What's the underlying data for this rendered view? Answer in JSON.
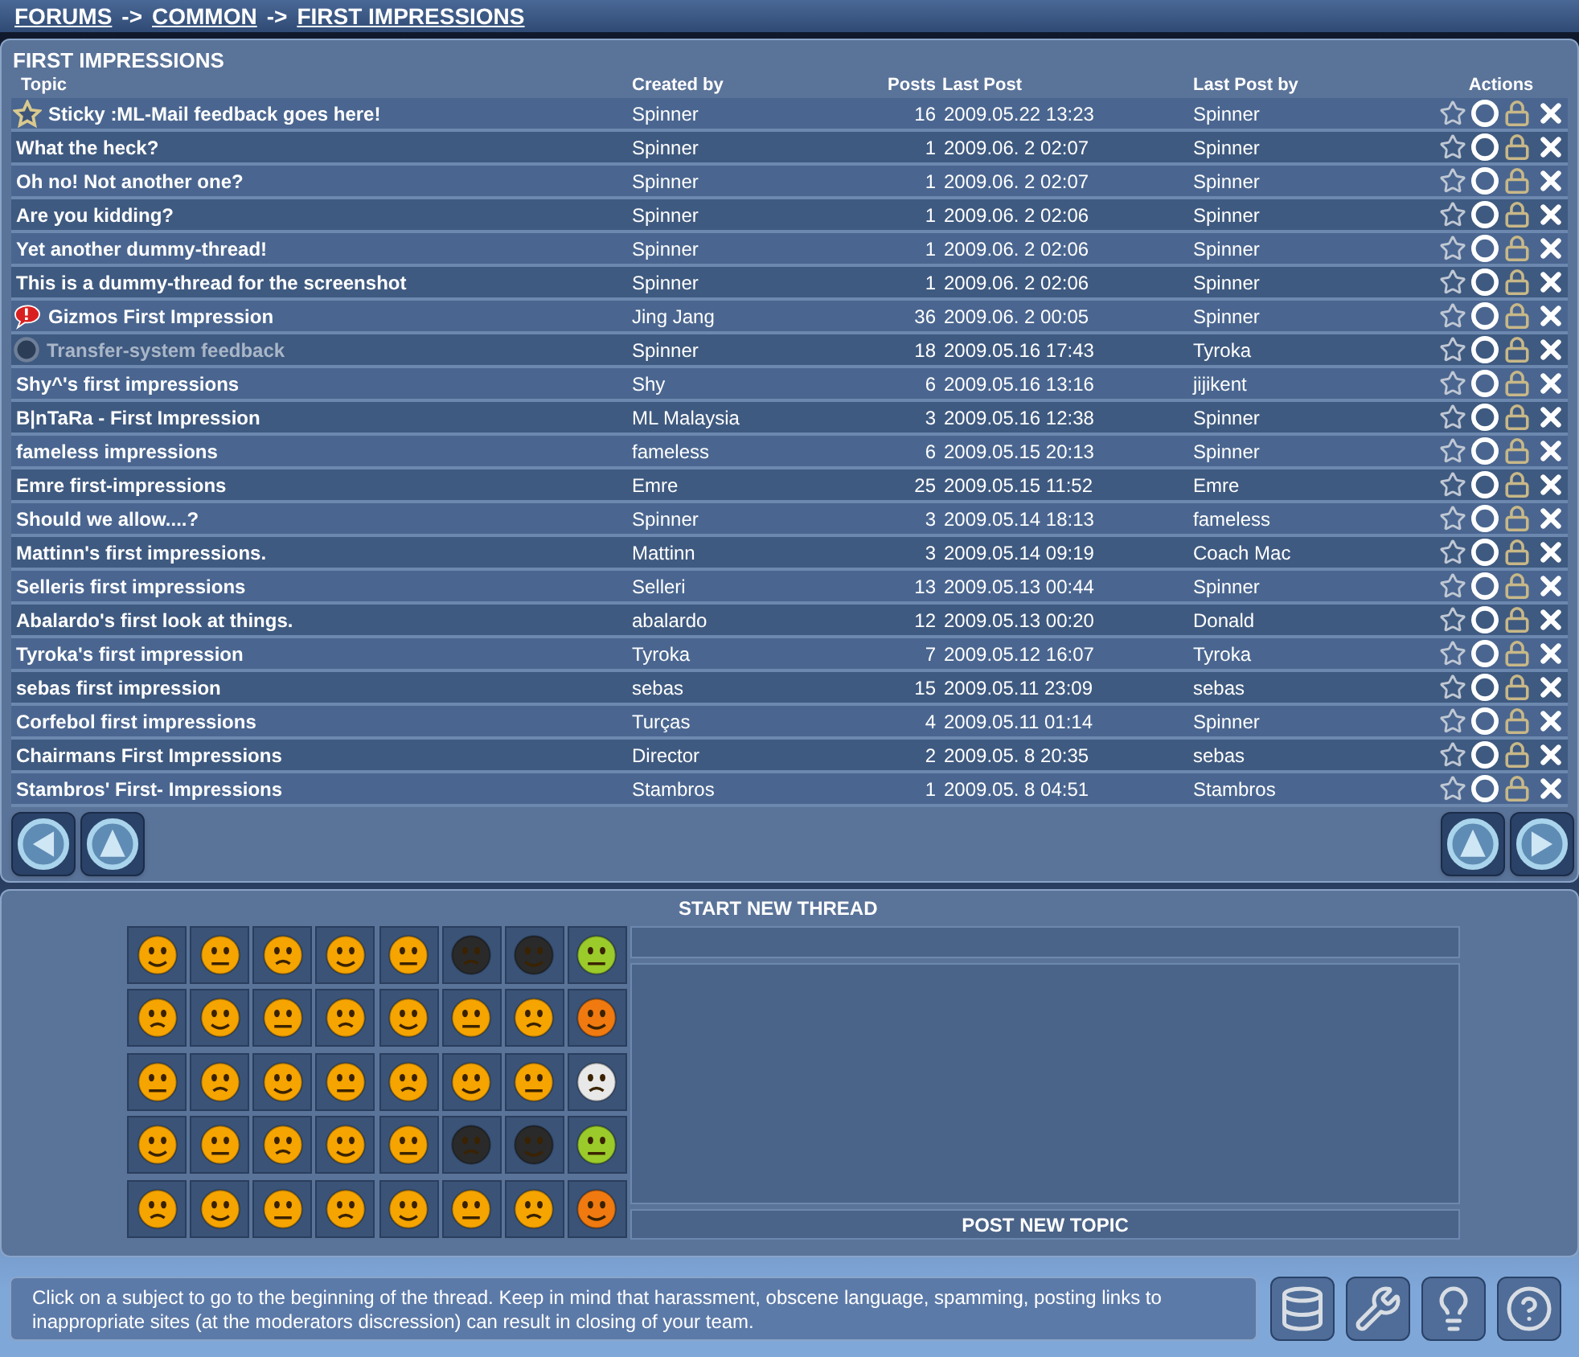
{
  "breadcrumb": {
    "items": [
      "FORUMS",
      "COMMON",
      "FIRST IMPRESSIONS"
    ],
    "separators": [
      "->",
      "->"
    ]
  },
  "forum": {
    "title": "FIRST IMPRESSIONS",
    "columns": [
      "Topic",
      "Created by",
      "Posts",
      "Last Post",
      "Last Post by",
      "Actions"
    ],
    "rows": [
      {
        "kind": "sticky",
        "topic": "Sticky :ML-Mail feedback goes here!",
        "created_by": "Spinner",
        "posts": "16",
        "last_post": "2009.05.22 13:23",
        "last_post_by": "Spinner"
      },
      {
        "kind": "normal",
        "topic": "What the heck?",
        "created_by": "Spinner",
        "posts": "1",
        "last_post": "2009.06. 2 02:07",
        "last_post_by": "Spinner"
      },
      {
        "kind": "normal",
        "topic": "Oh no! Not another one?",
        "created_by": "Spinner",
        "posts": "1",
        "last_post": "2009.06. 2 02:07",
        "last_post_by": "Spinner"
      },
      {
        "kind": "normal",
        "topic": "Are you kidding?",
        "created_by": "Spinner",
        "posts": "1",
        "last_post": "2009.06. 2 02:06",
        "last_post_by": "Spinner"
      },
      {
        "kind": "normal",
        "topic": "Yet another dummy-thread!",
        "created_by": "Spinner",
        "posts": "1",
        "last_post": "2009.06. 2 02:06",
        "last_post_by": "Spinner"
      },
      {
        "kind": "normal",
        "topic": "This is a dummy-thread for the screenshot",
        "created_by": "Spinner",
        "posts": "1",
        "last_post": "2009.06. 2 02:06",
        "last_post_by": "Spinner"
      },
      {
        "kind": "alert",
        "topic": "Gizmos First Impression",
        "created_by": "Jing Jang",
        "posts": "36",
        "last_post": "2009.06. 2 00:05",
        "last_post_by": "Spinner"
      },
      {
        "kind": "closed",
        "topic": "Transfer-system feedback",
        "created_by": "Spinner",
        "posts": "18",
        "last_post": "2009.05.16 17:43",
        "last_post_by": "Tyroka"
      },
      {
        "kind": "normal",
        "topic": "Shy^'s first impressions",
        "created_by": "Shy",
        "posts": "6",
        "last_post": "2009.05.16 13:16",
        "last_post_by": "jijikent"
      },
      {
        "kind": "normal",
        "topic": "B|nTaRa - First Impression",
        "created_by": "ML Malaysia",
        "posts": "3",
        "last_post": "2009.05.16 12:38",
        "last_post_by": "Spinner"
      },
      {
        "kind": "normal",
        "topic": "fameless impressions",
        "created_by": "fameless",
        "posts": "6",
        "last_post": "2009.05.15 20:13",
        "last_post_by": "Spinner"
      },
      {
        "kind": "normal",
        "topic": "Emre first-impressions",
        "created_by": "Emre",
        "posts": "25",
        "last_post": "2009.05.15 11:52",
        "last_post_by": "Emre"
      },
      {
        "kind": "normal",
        "topic": "Should we allow....?",
        "created_by": "Spinner",
        "posts": "3",
        "last_post": "2009.05.14 18:13",
        "last_post_by": "fameless"
      },
      {
        "kind": "normal",
        "topic": "Mattinn's first impressions.",
        "created_by": "Mattinn",
        "posts": "3",
        "last_post": "2009.05.14 09:19",
        "last_post_by": "Coach Mac"
      },
      {
        "kind": "normal",
        "topic": "Selleris first impressions",
        "created_by": "Selleri",
        "posts": "13",
        "last_post": "2009.05.13 00:44",
        "last_post_by": "Spinner"
      },
      {
        "kind": "normal",
        "topic": "Abalardo's first look at things.",
        "created_by": "abalardo",
        "posts": "12",
        "last_post": "2009.05.13 00:20",
        "last_post_by": "Donald"
      },
      {
        "kind": "normal",
        "topic": "Tyroka's first impression",
        "created_by": "Tyroka",
        "posts": "7",
        "last_post": "2009.05.12 16:07",
        "last_post_by": "Tyroka"
      },
      {
        "kind": "normal",
        "topic": "sebas first impression",
        "created_by": "sebas",
        "posts": "15",
        "last_post": "2009.05.11 23:09",
        "last_post_by": "sebas"
      },
      {
        "kind": "normal",
        "topic": "Corfebol first impressions",
        "created_by": "Turças",
        "posts": "4",
        "last_post": "2009.05.11 01:14",
        "last_post_by": "Spinner"
      },
      {
        "kind": "normal",
        "topic": "Chairmans First Impressions",
        "created_by": "Director",
        "posts": "2",
        "last_post": "2009.05. 8 20:35",
        "last_post_by": "sebas"
      },
      {
        "kind": "normal",
        "topic": "Stambros' First- Impressions",
        "created_by": "Stambros",
        "posts": "1",
        "last_post": "2009.05. 8 04:51",
        "last_post_by": "Stambros"
      }
    ]
  },
  "new_thread": {
    "title": "START NEW THREAD",
    "post_button": "POST NEW TOPIC"
  },
  "help_text": "Click on a subject to go to the beginning of the thread. Keep in mind that harassment, obscene language, spamming, posting links to inappropriate sites (at the moderators discression) can result in closing of your team."
}
